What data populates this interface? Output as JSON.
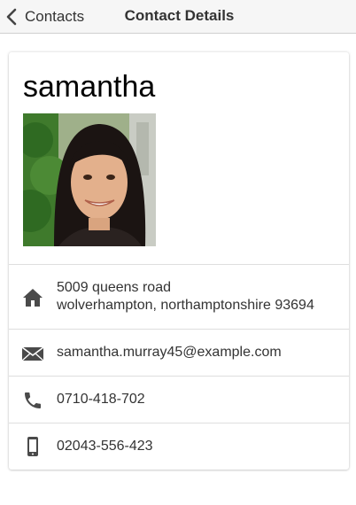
{
  "navbar": {
    "back_label": "Contacts",
    "title": "Contact Details"
  },
  "contact": {
    "name": "samantha",
    "address_line1": "5009 queens road",
    "address_line2": "wolverhampton, northamptonshire 93694",
    "email": "samantha.murray45@example.com",
    "phone": "0710-418-702",
    "mobile": "02043-556-423"
  },
  "icons": {
    "back": "chevron-left-icon",
    "address": "home-icon",
    "email": "envelope-icon",
    "phone": "phone-icon",
    "mobile": "mobile-phone-icon"
  },
  "colors": {
    "navbar_bg": "#f6f6f6",
    "icon": "#4a4a4a",
    "text": "#333333",
    "divider": "#dedede"
  }
}
